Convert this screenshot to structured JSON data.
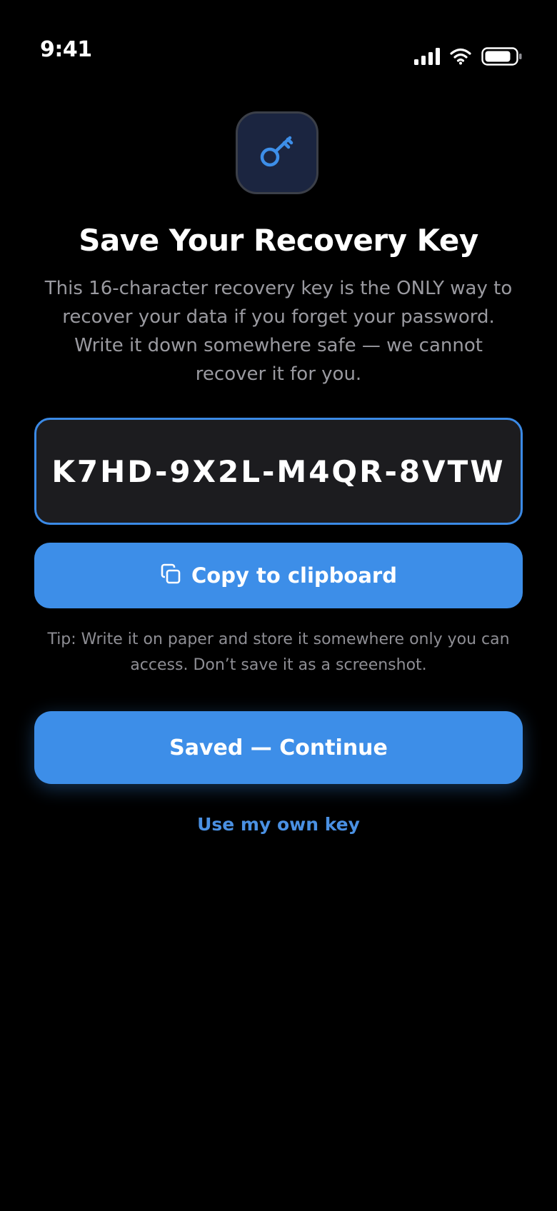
{
  "status_bar": {
    "time": "9:41"
  },
  "icons": {
    "app_icon": "key-icon",
    "copy_icon": "copy-icon",
    "signal_icon": "cellular-signal-icon",
    "wifi_icon": "wifi-icon",
    "battery_icon": "battery-icon"
  },
  "screen": {
    "title": "Save Your Recovery Key",
    "description": "This 16-character recovery key is the ONLY way to recover your data if you forget your password. Write it down somewhere safe — we cannot recover it for you.",
    "recovery_key": "K7HD-9X2L-M4QR-8VTW",
    "copy_button_label": "Copy to clipboard",
    "tip": "Tip: Write it on paper and store it somewhere only you can access. Don’t save it as a screenshot.",
    "continue_button_label": "Saved — Continue",
    "own_key_link": "Use my own key"
  },
  "colors": {
    "background": "#000000",
    "accent": "#3d8ee8",
    "link": "#4a90e2",
    "key_box_background": "#1c1c1f",
    "secondary_text": "#9a9aa0"
  }
}
